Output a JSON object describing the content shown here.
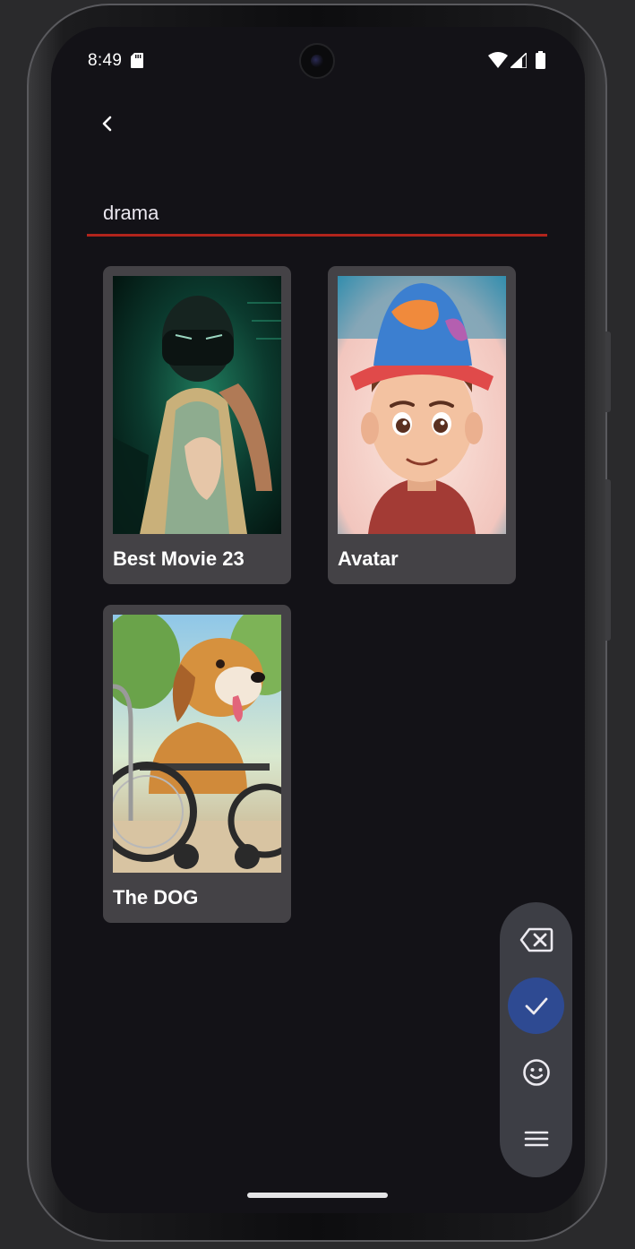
{
  "status_bar": {
    "time": "8:49",
    "icons": [
      "sd-card-icon",
      "wifi-icon",
      "signal-icon",
      "battery-icon"
    ]
  },
  "header": {
    "back_icon": "chevron-left-icon"
  },
  "search": {
    "value": "drama",
    "underline_color": "#b1241c"
  },
  "results": [
    {
      "title": "Best Movie 23",
      "poster": "masked-basketball-player-neon"
    },
    {
      "title": "Avatar",
      "poster": "cartoon-boy-with-bucket-hat"
    },
    {
      "title": "The DOG",
      "poster": "puppy-in-wheelchair"
    }
  ],
  "keyboard_toolbar": {
    "items": [
      "backspace-icon",
      "check-icon",
      "emoji-icon",
      "menu-icon"
    ],
    "active_color": "#2e4a92"
  },
  "colors": {
    "background": "#131217",
    "card": "#444246",
    "toolbar": "#3d3e45"
  }
}
